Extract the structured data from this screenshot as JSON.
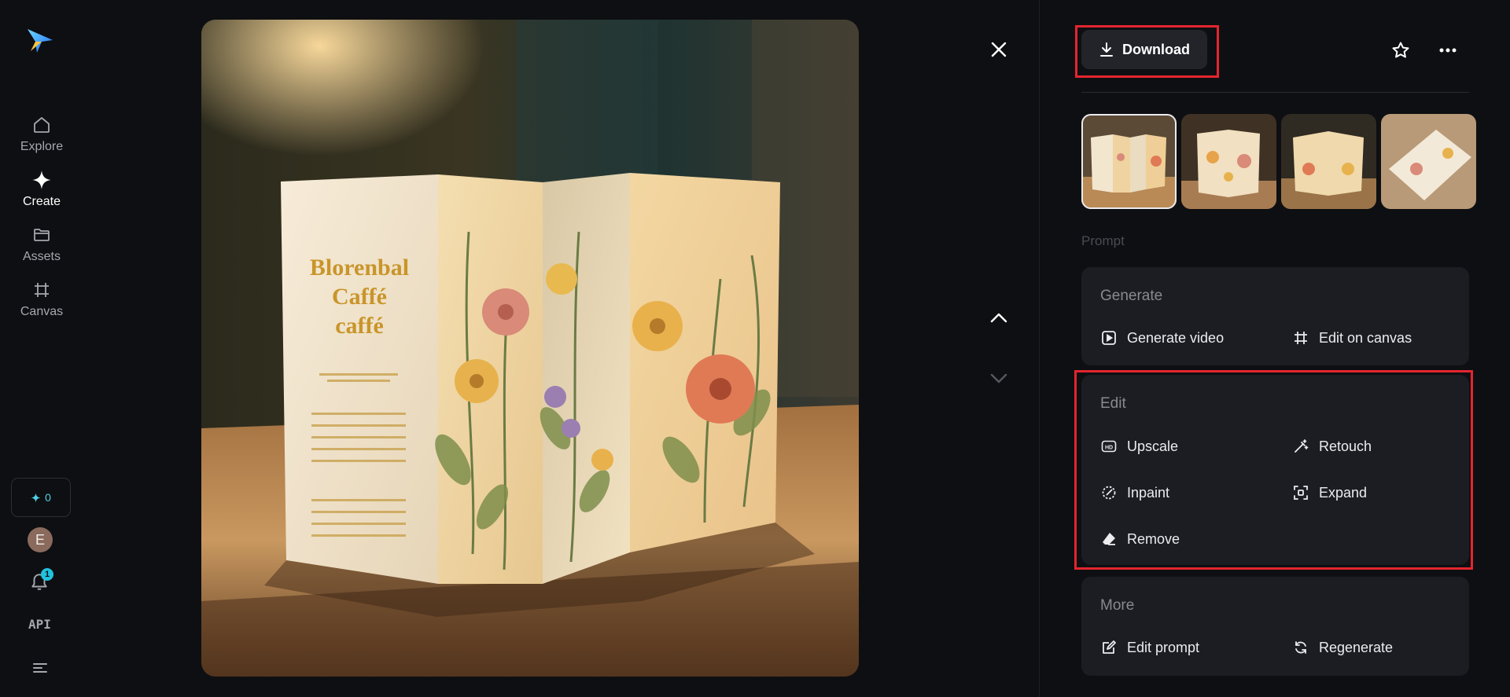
{
  "nav": {
    "items": [
      {
        "label": "Explore",
        "icon": "home-icon"
      },
      {
        "label": "Create",
        "icon": "sparkle-icon"
      },
      {
        "label": "Assets",
        "icon": "folder-icon"
      },
      {
        "label": "Canvas",
        "icon": "canvas-icon"
      }
    ],
    "active": "Create",
    "credits": "0",
    "avatar_initial": "E",
    "notification_count": "1",
    "api_label": "API"
  },
  "image_text": {
    "menu_title_line1": "Blorenbal",
    "menu_title_line2": "Caffé",
    "menu_title_line3": "caffé"
  },
  "toolbar": {
    "download_label": "Download"
  },
  "thumbnails_count": 4,
  "prompt_label": "Prompt",
  "sections": {
    "generate": {
      "title": "Generate",
      "actions": [
        {
          "label": "Generate video",
          "icon": "play-icon"
        },
        {
          "label": "Edit on canvas",
          "icon": "crop-icon"
        }
      ]
    },
    "edit": {
      "title": "Edit",
      "actions": [
        {
          "label": "Upscale",
          "icon": "hd-icon"
        },
        {
          "label": "Retouch",
          "icon": "magic-wand-icon"
        },
        {
          "label": "Inpaint",
          "icon": "inpaint-icon"
        },
        {
          "label": "Expand",
          "icon": "expand-icon"
        },
        {
          "label": "Remove",
          "icon": "eraser-icon"
        }
      ]
    },
    "more": {
      "title": "More",
      "actions": [
        {
          "label": "Edit prompt",
          "icon": "edit-prompt-icon"
        },
        {
          "label": "Regenerate",
          "icon": "regenerate-icon"
        }
      ]
    }
  },
  "colors": {
    "background": "#0e0f12",
    "card": "#1c1d22",
    "highlight": "#e3252f",
    "accent": "#1fc3df"
  }
}
